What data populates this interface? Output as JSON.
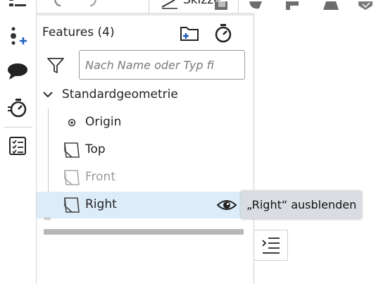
{
  "panel": {
    "title": "Features (4)",
    "search_placeholder": "Nach Name oder Typ fi",
    "group": {
      "label": "Standardgeometrie"
    },
    "items": [
      {
        "label": "Origin",
        "icon": "origin-icon",
        "state": "normal"
      },
      {
        "label": "Top",
        "icon": "plane-icon",
        "state": "normal"
      },
      {
        "label": "Front",
        "icon": "plane-icon",
        "state": "hidden"
      },
      {
        "label": "Right",
        "icon": "plane-icon",
        "state": "selected"
      }
    ],
    "tooltip": "„Right“ ausblenden"
  },
  "toolbar": {
    "sketch_label": "Skizze"
  },
  "colors": {
    "accent_blue": "#1f5fbf",
    "selected_row": "#dcecf8",
    "tooltip_bg": "#d9dde2"
  }
}
